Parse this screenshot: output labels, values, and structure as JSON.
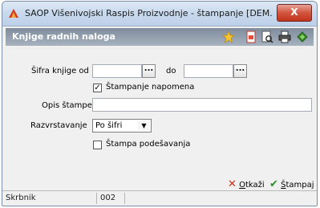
{
  "window": {
    "title": "SAOP   Višenivojski Raspis Proizvodnje - štampanje [DEM...",
    "close_label": "X"
  },
  "header": {
    "title": "Knjige radnih naloga",
    "icons": [
      "star-icon",
      "pdf-icon",
      "print-preview-icon",
      "printer-icon",
      "export-icon"
    ]
  },
  "form": {
    "sifra_od_label": "Šifra knjige od",
    "sifra_od_value": "",
    "sifra_do_label": "do",
    "sifra_do_value": "",
    "lookup_label": "...",
    "stampanje_napomena_label": "Štampanje napomena",
    "stampanje_napomena_checked": true,
    "opis_label": "Opis štampe",
    "opis_value": "",
    "razvrstavanje_label": "Razvrstavanje",
    "razvrstavanje_value": "Po šifri",
    "stampa_podesavanja_label": "Štampa podešavanja",
    "stampa_podesavanja_checked": false
  },
  "actions": {
    "cancel_label_prefix": "",
    "cancel_label_underline": "O",
    "cancel_label_rest": "tkaži",
    "print_label_prefix": "",
    "print_label_underline": "Š",
    "print_label_rest": "tampaj"
  },
  "status": {
    "user": "Skrbnik",
    "code": "002"
  },
  "colors": {
    "accent_red": "#c3331b",
    "accent_green": "#2e8b2e"
  }
}
